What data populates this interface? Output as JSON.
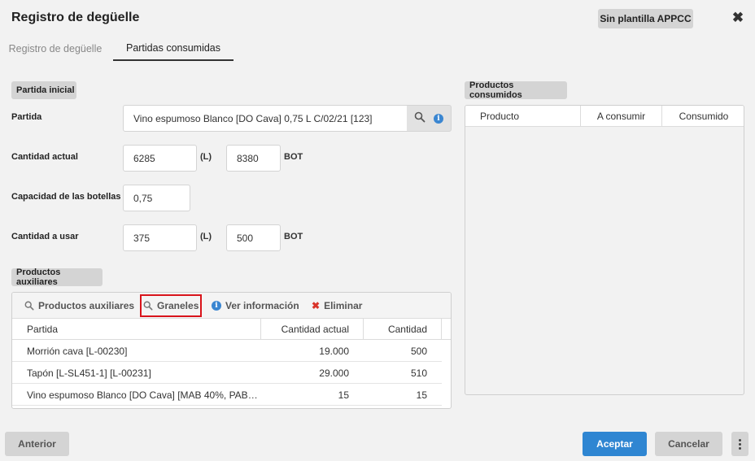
{
  "dialog": {
    "title": "Registro de degüelle",
    "appcc_badge": "Sin plantilla APPCC"
  },
  "tabs": [
    {
      "label": "Registro de degüelle",
      "active": false
    },
    {
      "label": "Partidas consumidas",
      "active": true
    }
  ],
  "partida_inicial": {
    "section_label": "Partida inicial",
    "partida_label": "Partida",
    "partida_value": "Vino espumoso Blanco [DO Cava] 0,75 L C/02/21 [123]",
    "cantidad_actual_label": "Cantidad actual",
    "cantidad_actual_l": "6285",
    "cantidad_actual_bot": "8380",
    "capacidad_label": "Capacidad de las botellas",
    "capacidad_value": "0,75",
    "cantidad_usar_label": "Cantidad a usar",
    "cantidad_usar_l": "375",
    "cantidad_usar_bot": "500",
    "unit_l": "(L)",
    "unit_bot": "BOT"
  },
  "productos_auxiliares": {
    "section_label": "Productos auxiliares",
    "toolbar": {
      "productos_auxiliares": "Productos auxiliares",
      "graneles": "Graneles",
      "ver_informacion": "Ver información",
      "eliminar": "Eliminar"
    },
    "columns": [
      "Partida",
      "Cantidad actual",
      "Cantidad"
    ],
    "rows": [
      {
        "partida": "Morrión cava [L-00230]",
        "cantidad_actual": "19.000",
        "cantidad": "500"
      },
      {
        "partida": "Tapón [L-SL451-1] [L-00231]",
        "cantidad_actual": "29.000",
        "cantidad": "510"
      },
      {
        "partida": "Vino espumoso Blanco [DO Cava] [MAB 40%, PAB…",
        "cantidad_actual": "15",
        "cantidad": "15"
      }
    ]
  },
  "productos_consumidos": {
    "section_label": "Productos consumidos",
    "columns": [
      "Producto",
      "A consumir",
      "Consumido"
    ]
  },
  "footer": {
    "anterior": "Anterior",
    "aceptar": "Aceptar",
    "cancelar": "Cancelar"
  },
  "colors": {
    "primary": "#2f86d2",
    "highlight": "#d9141b",
    "delete": "#d9342b"
  }
}
